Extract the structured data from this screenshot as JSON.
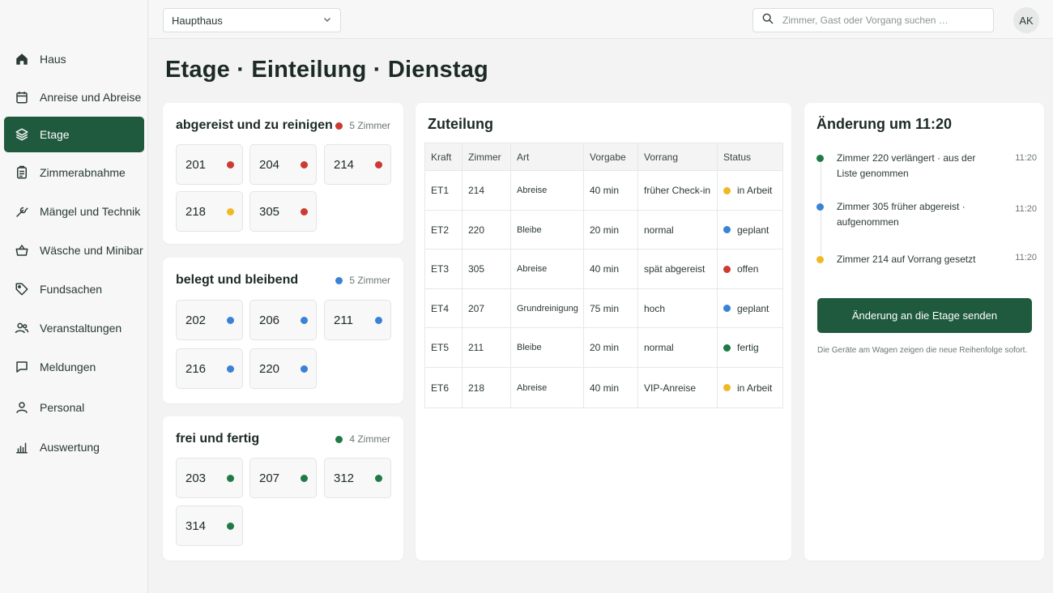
{
  "colors": {
    "accent": "#1f5a3e",
    "red": "#cc3b32",
    "yellow": "#f1b825",
    "blue": "#3a82d6",
    "green": "#1f7a45"
  },
  "nav": [
    {
      "label": "Haus",
      "icon": "home-icon"
    },
    {
      "label": "Anreise und Abreise",
      "icon": "calendar-icon"
    },
    {
      "label": "Etage",
      "icon": "layers-icon",
      "active": true
    },
    {
      "label": "Zimmerabnahme",
      "icon": "clipboard-icon"
    },
    {
      "label": "Mängel und Technik",
      "icon": "wrench-icon"
    },
    {
      "label": "Wäsche und Minibar",
      "icon": "basket-icon"
    },
    {
      "label": "Fundsachen",
      "icon": "tag-icon"
    },
    {
      "label": "Veranstaltungen",
      "icon": "users-icon"
    },
    {
      "label": "Meldungen",
      "icon": "message-icon"
    },
    {
      "label": "Personal",
      "icon": "person-icon"
    },
    {
      "label": "Auswertung",
      "icon": "bar-chart-icon"
    }
  ],
  "topbar": {
    "building": "Haupthaus",
    "search_placeholder": "Zimmer, Gast oder Vorgang suchen …",
    "avatar": "AK"
  },
  "page_title": "Etage · Einteilung · Dienstag",
  "groups": [
    {
      "title": "abgereist und zu reinigen",
      "count": "5 Zimmer",
      "color": "red",
      "rooms": [
        {
          "n": "201",
          "c": "red"
        },
        {
          "n": "204",
          "c": "red"
        },
        {
          "n": "214",
          "c": "red"
        },
        {
          "n": "218",
          "c": "yellow"
        },
        {
          "n": "305",
          "c": "red"
        }
      ]
    },
    {
      "title": "belegt und bleibend",
      "count": "5 Zimmer",
      "color": "blue",
      "rooms": [
        {
          "n": "202",
          "c": "blue"
        },
        {
          "n": "206",
          "c": "blue"
        },
        {
          "n": "211",
          "c": "blue"
        },
        {
          "n": "216",
          "c": "blue"
        },
        {
          "n": "220",
          "c": "blue"
        }
      ]
    },
    {
      "title": "frei und fertig",
      "count": "4 Zimmer",
      "color": "green",
      "rooms": [
        {
          "n": "203",
          "c": "green"
        },
        {
          "n": "207",
          "c": "green"
        },
        {
          "n": "312",
          "c": "green"
        },
        {
          "n": "314",
          "c": "green"
        }
      ]
    }
  ],
  "assignment": {
    "title": "Zuteilung",
    "columns": [
      "Kraft",
      "Zimmer",
      "Art",
      "Vorgabe",
      "Vorrang",
      "Status"
    ],
    "rows": [
      {
        "kraft": "ET1",
        "zimmer": "214",
        "art": "Abreise",
        "vorgabe": "40 min",
        "vorrang": "früher Check-in",
        "status": "in Arbeit",
        "c": "yellow"
      },
      {
        "kraft": "ET2",
        "zimmer": "220",
        "art": "Bleibe",
        "vorgabe": "20 min",
        "vorrang": "normal",
        "status": "geplant",
        "c": "blue"
      },
      {
        "kraft": "ET3",
        "zimmer": "305",
        "art": "Abreise",
        "vorgabe": "40 min",
        "vorrang": "spät abgereist",
        "status": "offen",
        "c": "red"
      },
      {
        "kraft": "ET4",
        "zimmer": "207",
        "art": "Grundreinigung",
        "vorgabe": "75 min",
        "vorrang": "hoch",
        "status": "geplant",
        "c": "blue"
      },
      {
        "kraft": "ET5",
        "zimmer": "211",
        "art": "Bleibe",
        "vorgabe": "20 min",
        "vorrang": "normal",
        "status": "fertig",
        "c": "green"
      },
      {
        "kraft": "ET6",
        "zimmer": "218",
        "art": "Abreise",
        "vorgabe": "40 min",
        "vorrang": "VIP-Anreise",
        "status": "in Arbeit",
        "c": "yellow"
      }
    ]
  },
  "changes": {
    "title": "Änderung um 11:20",
    "items": [
      {
        "text": "Zimmer 220 verlängert · aus der Liste genommen",
        "time": "11:20",
        "c": "green"
      },
      {
        "text": "Zimmer 305 früher abgereist · aufgenommen",
        "time": "11:20",
        "c": "blue"
      },
      {
        "text": "Zimmer 214 auf Vorrang gesetzt",
        "time": "11:20",
        "c": "yellow"
      }
    ],
    "button": "Änderung an die Etage senden",
    "hint": "Die Geräte am Wagen zeigen die neue Reihenfolge sofort."
  }
}
